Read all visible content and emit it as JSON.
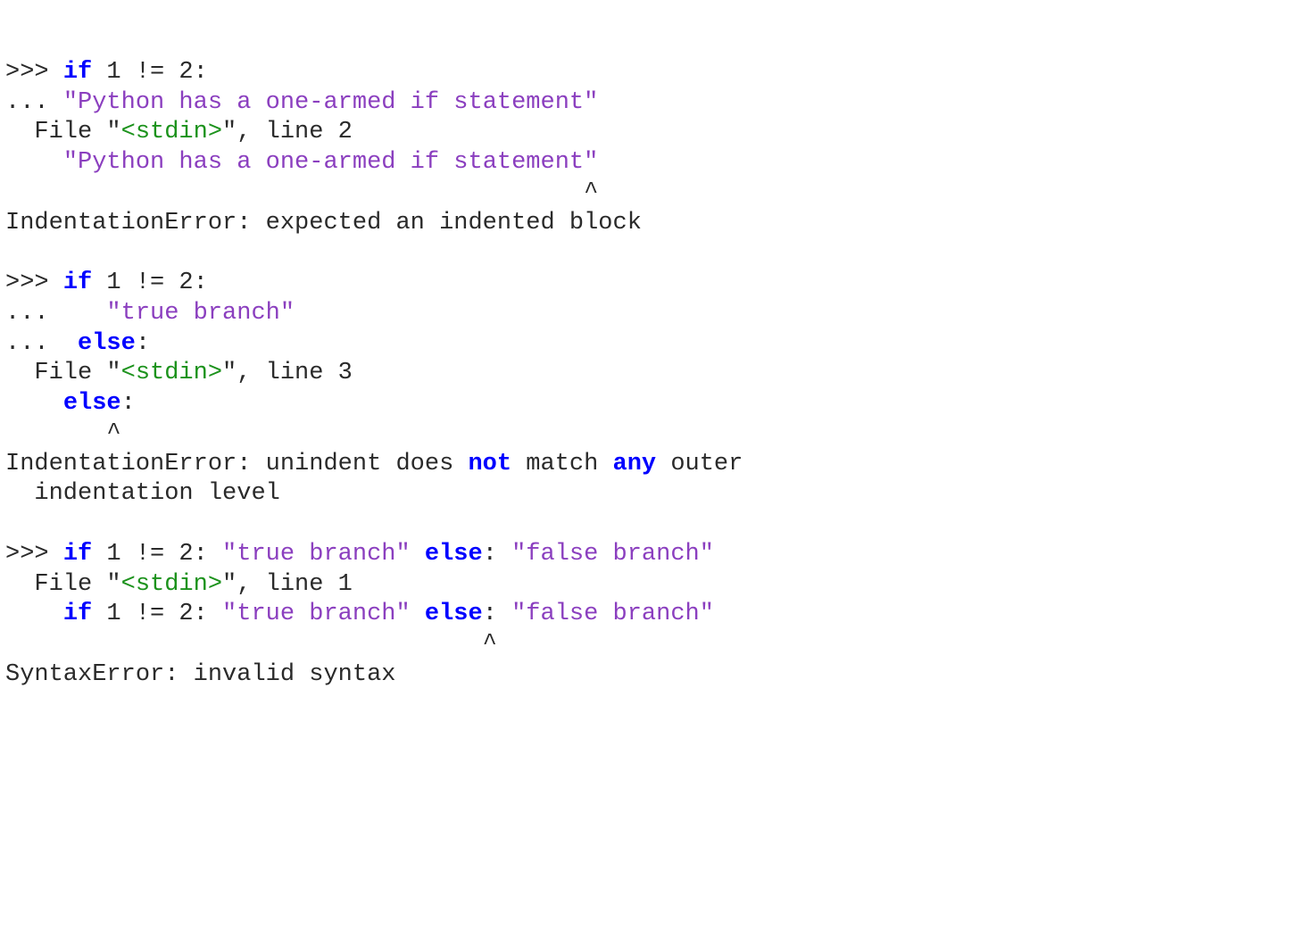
{
  "code": [
    [
      {
        "t": ">>> ",
        "cls": ""
      },
      {
        "t": "if",
        "cls": "keyword"
      },
      {
        "t": " 1 != 2:",
        "cls": ""
      }
    ],
    [
      {
        "t": "... ",
        "cls": ""
      },
      {
        "t": "\"Python has a one-armed if statement\"",
        "cls": "string"
      }
    ],
    [
      {
        "t": "  File ",
        "cls": ""
      },
      {
        "t": "\"",
        "cls": ""
      },
      {
        "t": "<stdin>",
        "cls": "err-str"
      },
      {
        "t": "\", line 2",
        "cls": ""
      }
    ],
    [
      {
        "t": "    ",
        "cls": ""
      },
      {
        "t": "\"Python has a one-armed if statement\"",
        "cls": "string"
      }
    ],
    [
      {
        "t": "                                        ^",
        "cls": ""
      }
    ],
    [
      {
        "t": "IndentationError: expected an indented block",
        "cls": ""
      }
    ],
    [
      {
        "t": "",
        "cls": ""
      }
    ],
    [
      {
        "t": ">>> ",
        "cls": ""
      },
      {
        "t": "if",
        "cls": "keyword"
      },
      {
        "t": " 1 != 2:",
        "cls": ""
      }
    ],
    [
      {
        "t": "...    ",
        "cls": ""
      },
      {
        "t": "\"true branch\"",
        "cls": "string"
      }
    ],
    [
      {
        "t": "...  ",
        "cls": ""
      },
      {
        "t": "else",
        "cls": "keyword"
      },
      {
        "t": ":",
        "cls": ""
      }
    ],
    [
      {
        "t": "  File ",
        "cls": ""
      },
      {
        "t": "\"",
        "cls": ""
      },
      {
        "t": "<stdin>",
        "cls": "err-str"
      },
      {
        "t": "\", line 3",
        "cls": ""
      }
    ],
    [
      {
        "t": "    ",
        "cls": ""
      },
      {
        "t": "else",
        "cls": "keyword"
      },
      {
        "t": ":",
        "cls": ""
      }
    ],
    [
      {
        "t": "       ^",
        "cls": ""
      }
    ],
    [
      {
        "t": "IndentationError: unindent does ",
        "cls": ""
      },
      {
        "t": "not",
        "cls": "keyword"
      },
      {
        "t": " match ",
        "cls": ""
      },
      {
        "t": "any",
        "cls": "keyword"
      },
      {
        "t": " outer",
        "cls": ""
      }
    ],
    [
      {
        "t": "  indentation level",
        "cls": ""
      }
    ],
    [
      {
        "t": "",
        "cls": ""
      }
    ],
    [
      {
        "t": ">>> ",
        "cls": ""
      },
      {
        "t": "if",
        "cls": "keyword"
      },
      {
        "t": " 1 != 2: ",
        "cls": ""
      },
      {
        "t": "\"true branch\"",
        "cls": "string"
      },
      {
        "t": " ",
        "cls": ""
      },
      {
        "t": "else",
        "cls": "keyword"
      },
      {
        "t": ": ",
        "cls": ""
      },
      {
        "t": "\"false branch\"",
        "cls": "string"
      }
    ],
    [
      {
        "t": "  File ",
        "cls": ""
      },
      {
        "t": "\"",
        "cls": ""
      },
      {
        "t": "<stdin>",
        "cls": "err-str"
      },
      {
        "t": "\", line 1",
        "cls": ""
      }
    ],
    [
      {
        "t": "    ",
        "cls": ""
      },
      {
        "t": "if",
        "cls": "keyword"
      },
      {
        "t": " 1 != 2: ",
        "cls": ""
      },
      {
        "t": "\"true branch\"",
        "cls": "string"
      },
      {
        "t": " ",
        "cls": ""
      },
      {
        "t": "else",
        "cls": "keyword"
      },
      {
        "t": ": ",
        "cls": ""
      },
      {
        "t": "\"false branch\"",
        "cls": "string"
      }
    ],
    [
      {
        "t": "                                 ^",
        "cls": ""
      }
    ],
    [
      {
        "t": "SyntaxError: invalid syntax",
        "cls": ""
      }
    ]
  ]
}
